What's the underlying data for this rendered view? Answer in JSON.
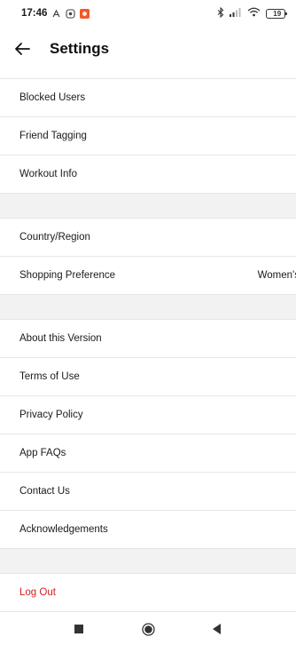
{
  "status_bar": {
    "time": "17:46",
    "notification_icons": [
      "signal-sync-icon",
      "screen-record-icon",
      "app-notification-icon"
    ],
    "right_icons": [
      "bluetooth-icon",
      "cellular-signal-icon",
      "wifi-icon"
    ],
    "battery_level": "19",
    "battery_color": "#f3c21c"
  },
  "app_bar": {
    "title": "Settings",
    "back_icon": "back-arrow-icon"
  },
  "sections": [
    {
      "items": [
        {
          "label": "Blocked Users"
        },
        {
          "label": "Friend Tagging"
        },
        {
          "label": "Workout Info"
        }
      ]
    },
    {
      "items": [
        {
          "label": "Country/Region"
        },
        {
          "label": "Shopping Preference",
          "value": "Women's"
        }
      ]
    },
    {
      "items": [
        {
          "label": "About this Version"
        },
        {
          "label": "Terms of Use"
        },
        {
          "label": "Privacy Policy"
        },
        {
          "label": "App FAQs"
        },
        {
          "label": "Contact Us"
        },
        {
          "label": "Acknowledgements"
        }
      ]
    },
    {
      "items": [
        {
          "label": "Log Out"
        }
      ]
    }
  ],
  "colors": {
    "logout_text": "#d21f1f",
    "section_gap": "#f2f2f2",
    "divider": "#e6e6e6"
  },
  "nav_bar": {
    "icons": [
      "recents-square-icon",
      "home-circle-icon",
      "back-triangle-icon"
    ]
  }
}
